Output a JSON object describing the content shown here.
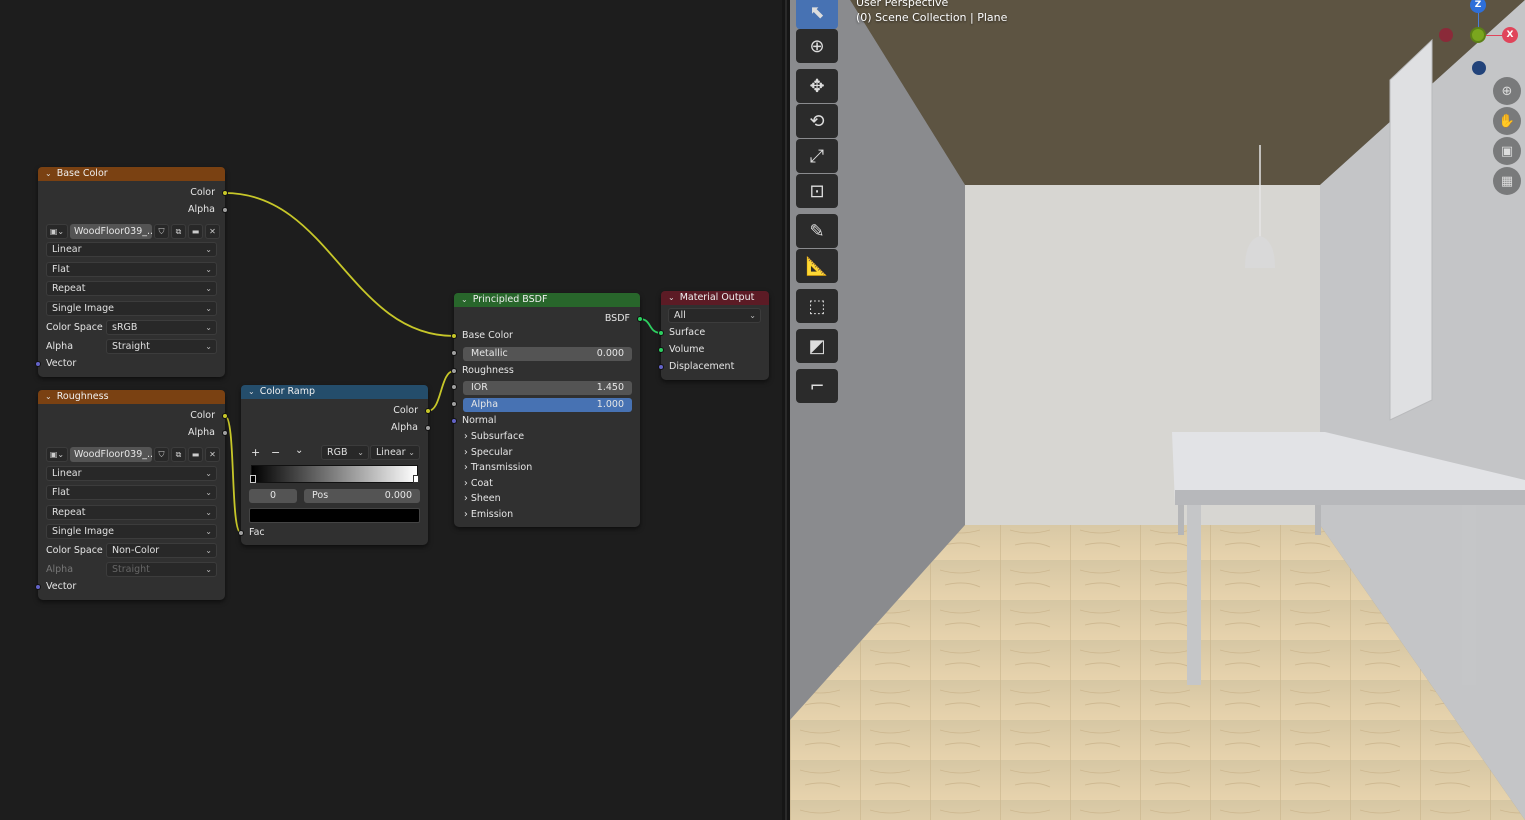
{
  "viewport": {
    "line1": "User Perspective",
    "line2": "(0) Scene Collection | Plane",
    "gizmo": {
      "z": "Z",
      "x": "X"
    },
    "tools": [
      "select-box-icon",
      "cursor-icon",
      "move-icon",
      "rotate-icon",
      "scale-icon",
      "transform-icon",
      "annotate-icon",
      "measure-icon",
      "add-cube-icon",
      "shrink-icon",
      "extrude-icon"
    ],
    "nav": [
      "zoom-icon",
      "hand-pan-icon",
      "camera-icon",
      "grid-perspective-icon"
    ]
  },
  "nodes": {
    "base_color": {
      "title": "Base Color",
      "out_color": "Color",
      "out_alpha": "Alpha",
      "image_name": "WoodFloor039_...",
      "interpolation": "Linear",
      "projection": "Flat",
      "extension": "Repeat",
      "source": "Single Image",
      "color_space_label": "Color Space",
      "color_space": "sRGB",
      "alpha_label": "Alpha",
      "alpha_mode": "Straight",
      "in_vector": "Vector"
    },
    "roughness": {
      "title": "Roughness",
      "out_color": "Color",
      "out_alpha": "Alpha",
      "image_name": "WoodFloor039_...",
      "interpolation": "Linear",
      "projection": "Flat",
      "extension": "Repeat",
      "source": "Single Image",
      "color_space_label": "Color Space",
      "color_space": "Non-Color",
      "alpha_label": "Alpha",
      "alpha_mode": "Straight",
      "in_vector": "Vector"
    },
    "color_ramp": {
      "title": "Color Ramp",
      "out_color": "Color",
      "out_alpha": "Alpha",
      "add": "+",
      "remove": "−",
      "menu": "⌄",
      "color_mode": "RGB",
      "interpolation": "Linear",
      "stop_index": "0",
      "pos_label": "Pos",
      "pos_value": "0.000",
      "in_fac": "Fac"
    },
    "principled": {
      "title": "Principled BSDF",
      "out_bsdf": "BSDF",
      "base_color": "Base Color",
      "metallic_label": "Metallic",
      "metallic_value": "0.000",
      "roughness": "Roughness",
      "ior_label": "IOR",
      "ior_value": "1.450",
      "alpha_label": "Alpha",
      "alpha_value": "1.000",
      "normal": "Normal",
      "panels": [
        "Subsurface",
        "Specular",
        "Transmission",
        "Coat",
        "Sheen",
        "Emission"
      ]
    },
    "material_output": {
      "title": "Material Output",
      "target": "All",
      "surface": "Surface",
      "volume": "Volume",
      "displacement": "Displacement"
    }
  }
}
